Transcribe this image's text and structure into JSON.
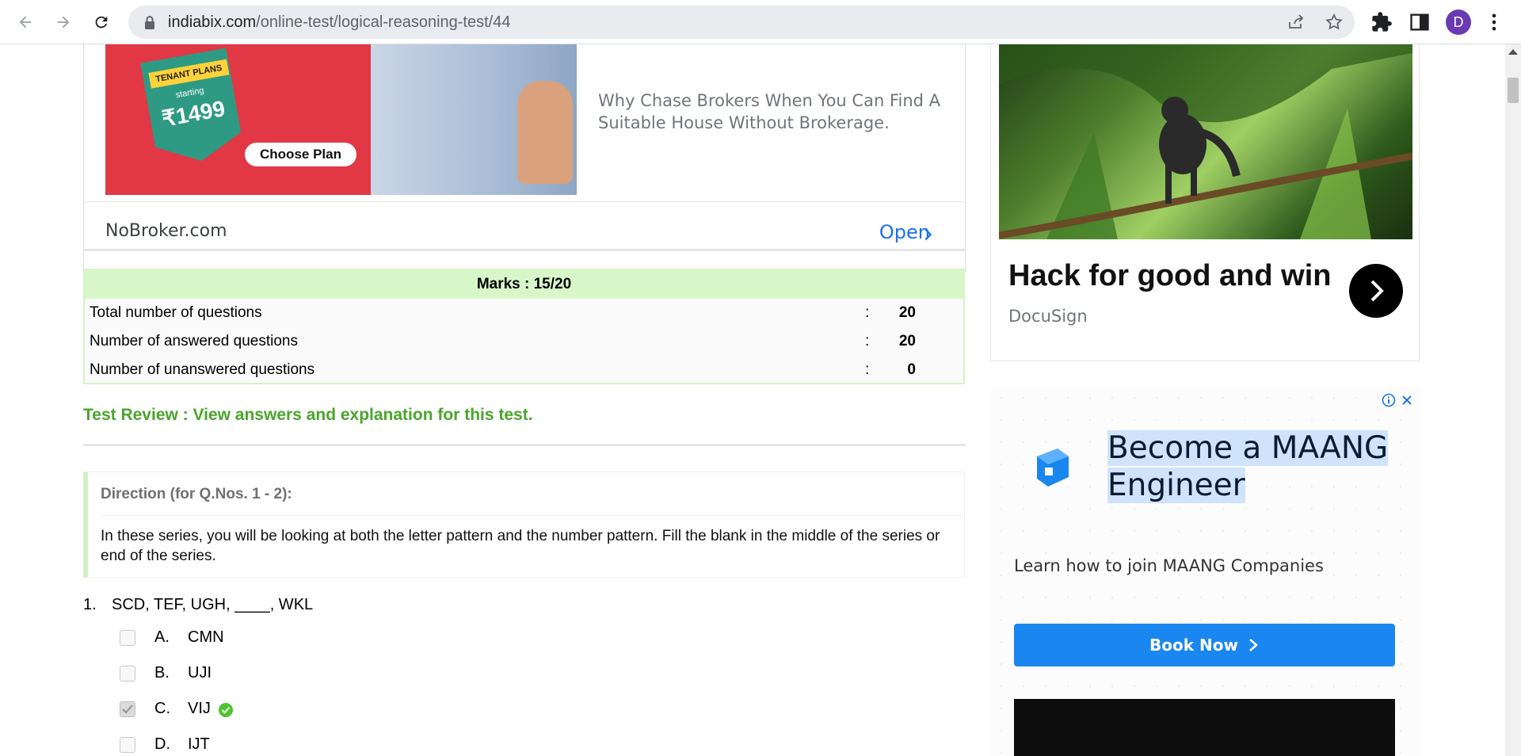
{
  "browser": {
    "url_host": "indiabix.com",
    "url_path": "/online-test/logical-reasoning-test/44",
    "avatar_letter": "D"
  },
  "ad_top": {
    "badge_title": "TENANT PLANS",
    "badge_sub": "starting",
    "badge_price": "₹1499",
    "cta": "Choose Plan",
    "text": "Why Chase Brokers When You Can Find A Suitable House Without Brokerage.",
    "brand": "NoBroker.com",
    "open": "Open"
  },
  "marks": {
    "title": "Marks : 15/20",
    "rows": [
      {
        "label": "Total number of questions",
        "sep": ":",
        "value": "20"
      },
      {
        "label": "Number of answered questions",
        "sep": ":",
        "value": "20"
      },
      {
        "label": "Number of unanswered questions",
        "sep": ":",
        "value": "0"
      }
    ]
  },
  "review_link": "Test Review : View answers and explanation for this test.",
  "direction": {
    "title": "Direction (for Q.Nos. 1 - 2):",
    "text": "In these series, you will be looking at both the letter pattern and the number pattern. Fill the blank in the middle of the series or end of the series."
  },
  "question": {
    "number": "1.",
    "text": "SCD, TEF, UGH, ____, WKL",
    "options": [
      {
        "letter": "A.",
        "text": "CMN",
        "checked": false,
        "correct": false
      },
      {
        "letter": "B.",
        "text": "UJI",
        "checked": false,
        "correct": false
      },
      {
        "letter": "C.",
        "text": "VIJ",
        "checked": true,
        "correct": true
      },
      {
        "letter": "D.",
        "text": "IJT",
        "checked": false,
        "correct": false
      }
    ]
  },
  "ad_right_1": {
    "title": "Hack for good and win",
    "sub": "DocuSign"
  },
  "ad_right_2": {
    "title": "Become a MAANG Engineer",
    "sub": "Learn how to join MAANG Companies",
    "button": "Book Now"
  },
  "colors": {
    "accent_green": "#4aa52b",
    "marks_header_bg": "#d8f7c9",
    "link_blue": "#1a73e8",
    "cta_blue": "#1a86f0"
  }
}
